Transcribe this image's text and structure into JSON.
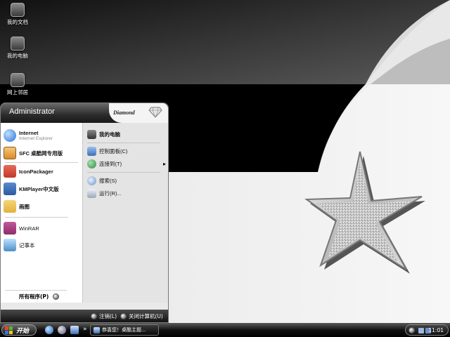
{
  "desktop_icons": [
    {
      "label": "我的文档",
      "icon": "my-documents-icon"
    },
    {
      "label": "我的电脑",
      "icon": "my-computer-icon"
    },
    {
      "label": "网上邻居",
      "icon": "network-places-icon"
    }
  ],
  "start_menu": {
    "user_name": "Administrator",
    "brand": "Diamond",
    "pinned": [
      {
        "label": "Internet",
        "sublabel": "Internet Explorer",
        "icon": "internet-explorer-icon",
        "color": "#2a6fd6"
      },
      {
        "label": "SFC 桌酷网专用版",
        "icon": "sfc-icon",
        "color": "#d98a2a"
      }
    ],
    "recent": [
      {
        "label": "IconPackager",
        "icon": "iconpackager-icon",
        "color": "#c0392b"
      },
      {
        "label": "KMPlayer中文版",
        "icon": "kmplayer-icon",
        "color": "#2c5aa0"
      },
      {
        "label": "画图",
        "icon": "paint-icon",
        "color": "#e2b23c"
      },
      {
        "label": "WinRAR",
        "icon": "winrar-icon",
        "color": "#8e2b6b"
      },
      {
        "label": "记事本",
        "icon": "notepad-icon",
        "color": "#4a90c8"
      }
    ],
    "all_programs": "所有程序(P)",
    "right_items": [
      {
        "label": "我的电脑",
        "icon": "my-computer-icon",
        "color": "#333333",
        "bold": true
      },
      {
        "label": "控制面板(C)",
        "icon": "control-panel-icon",
        "color": "#3b6fb6"
      },
      {
        "label": "连接到(T)",
        "icon": "connect-to-icon",
        "color": "#2b8a3e",
        "arrow": "▸"
      },
      {
        "label": "搜索(S)",
        "icon": "search-icon",
        "color": "#6a8fc0"
      },
      {
        "label": "运行(R)...",
        "icon": "run-icon",
        "color": "#9aa6b8"
      }
    ],
    "logoff": "注销(L)",
    "shutdown": "关闭计算机(U)"
  },
  "taskbar": {
    "start_label": "开始",
    "quick_launch": [
      "ie-quick-icon",
      "media-quick-icon",
      "desktop-quick-icon"
    ],
    "overflow": "»",
    "task_label": "恭喜您！桌酷主题...",
    "clock": "11:01"
  },
  "colors": {
    "wallpaper_dark": "#000000",
    "wallpaper_light": "#d9d9d9",
    "menu_header": "#2b2b2b",
    "taskbar": "#111111"
  }
}
